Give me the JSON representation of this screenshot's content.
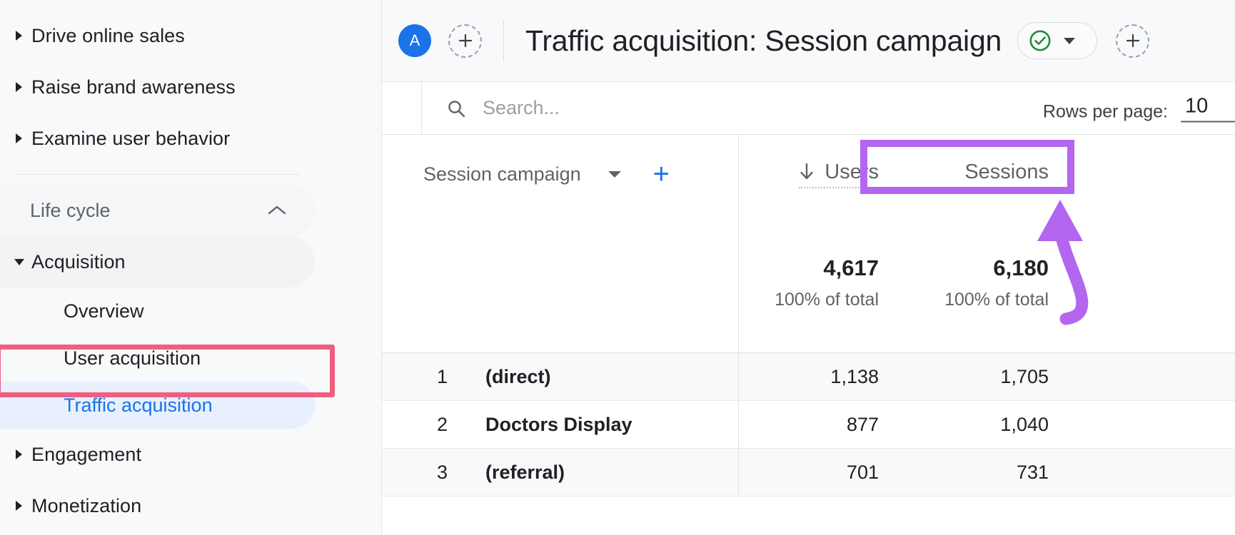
{
  "sidebar": {
    "top_items": [
      {
        "label": "Drive online sales",
        "icon": "chevron-right-icon"
      },
      {
        "label": "Raise brand awareness",
        "icon": "chevron-right-icon"
      },
      {
        "label": "Examine user behavior",
        "icon": "chevron-right-icon"
      }
    ],
    "group": {
      "label": "Life cycle",
      "icon": "chevron-up-icon"
    },
    "acquisition": {
      "label": "Acquisition",
      "icon": "chevron-down-icon"
    },
    "sub_items": [
      {
        "label": "Overview",
        "selected": false
      },
      {
        "label": "User acquisition",
        "selected": false
      },
      {
        "label": "Traffic acquisition",
        "selected": true
      }
    ],
    "bottom_items": [
      {
        "label": "Engagement",
        "icon": "chevron-right-icon"
      },
      {
        "label": "Monetization",
        "icon": "chevron-right-icon"
      }
    ],
    "selected_color": "#1a73e8",
    "selected_bg": "#e8f0fe",
    "annotation_color": "#ef5f80"
  },
  "topbar": {
    "avatar_letter": "A",
    "add_comparison_icon": "plus-icon",
    "title": "Traffic acquisition: Session campaign",
    "status_icon": "check-circle-icon",
    "status_dropdown_icon": "caret-down-icon",
    "add_icon": "plus-icon",
    "status_color": "#1e8e3e",
    "avatar_color": "#1a73e8"
  },
  "toolbar": {
    "search_icon": "search-icon",
    "search_value": "",
    "search_placeholder": "Search...",
    "rows_per_page_label": "Rows per page:",
    "rows_per_page_value": "10"
  },
  "table": {
    "dimension_selector": {
      "label": "Session campaign",
      "dropdown_icon": "caret-down-icon",
      "add_dimension_icon": "plus-icon",
      "highlight_color": "#b366f0"
    },
    "columns": [
      {
        "label": "Users",
        "sort_icon": "arrow-down-icon",
        "sorted": true
      },
      {
        "label": "Sessions",
        "sort_icon": "",
        "sorted": false
      }
    ],
    "totals": {
      "users": {
        "value": "4,617",
        "sub": "100% of total"
      },
      "sessions": {
        "value": "6,180",
        "sub": "100% of total"
      }
    },
    "rows": [
      {
        "rank": "1",
        "name": "(direct)",
        "users": "1,138",
        "sessions": "1,705"
      },
      {
        "rank": "2",
        "name": "Doctors Display",
        "users": "877",
        "sessions": "1,040"
      },
      {
        "rank": "3",
        "name": "(referral)",
        "users": "701",
        "sessions": "731"
      }
    ]
  },
  "annotations": {
    "arrow_color": "#b366f0",
    "arrow_name": "curved-arrow-pointing-to-dimension-selector"
  }
}
